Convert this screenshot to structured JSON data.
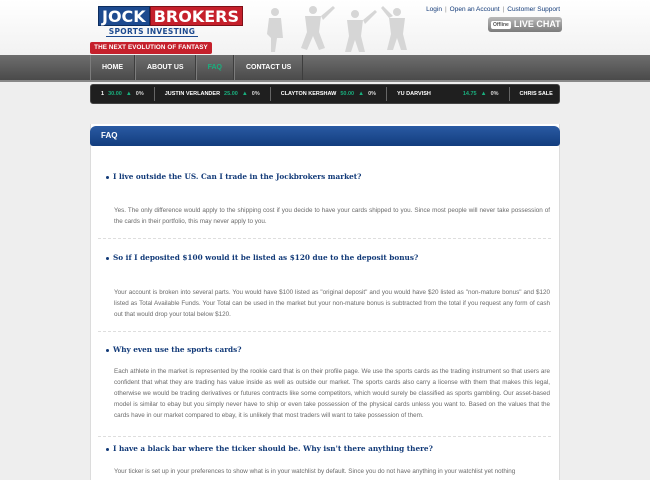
{
  "brand": {
    "name_part1": "JOCK",
    "name_part2": "BROKERS",
    "subtitle": "SPORTS INVESTING",
    "tagline": "THE NEXT EVOLUTION OF FANTASY SPORTS",
    "colors": {
      "blue": "#1d4a8f",
      "red": "#c5202b",
      "accent_green": "#19b07e"
    }
  },
  "top_links": [
    {
      "label": "Login"
    },
    {
      "label": "Open an Account"
    },
    {
      "label": "Customer Support"
    }
  ],
  "live_chat": {
    "badge": "Offline",
    "label": "LIVE CHAT"
  },
  "nav": [
    {
      "label": "HOME",
      "active": false
    },
    {
      "label": "ABOUT US",
      "active": false
    },
    {
      "label": "FAQ",
      "active": true
    },
    {
      "label": "CONTACT US",
      "active": false
    }
  ],
  "ticker": [
    {
      "name": "",
      "price": "1",
      "value": "30.00",
      "change": "0%"
    },
    {
      "name": "JUSTIN VERLANDER",
      "price": "",
      "value": "25.00",
      "change": "0%"
    },
    {
      "name": "CLAYTON KERSHAW",
      "price": "",
      "value": "50.00",
      "change": "0%"
    },
    {
      "name": "YU DARVISH",
      "price": "",
      "value": "14.75",
      "change": "0%"
    },
    {
      "name": "CHRIS SALE",
      "price": "",
      "value": "",
      "change": ""
    }
  ],
  "faq": {
    "header": "FAQ",
    "items": [
      {
        "question": "I live outside the US. Can I trade in the Jockbrokers market?",
        "answer": "Yes. The only difference would apply to the shipping cost if you decide to have your cards shipped to you. Since most people will never take possession of the cards in their portfolio, this may never apply to you."
      },
      {
        "question": "So if I deposited $100 would it be listed as $120 due to the deposit bonus?",
        "answer": "Your account is broken into several parts. You would have $100 listed as \"original deposit\" and you would have $20 listed as \"non-mature bonus\" and $120 listed as Total Available Funds. Your Total can be used in the market but your non-mature bonus is subtracted from the total if you request any form of cash out that would drop your total below $120."
      },
      {
        "question": "Why even use the sports cards?",
        "answer": "Each athlete in the market is represented by the rookie card that is on their profile page. We use the sports cards as the trading instrument so that users are confident that what they are trading has value inside as well as outside our market. The sports cards also carry a license with them that makes this legal, otherwise we would be trading derivatives or futures contracts like some competitors, which would surely be classified as sports gambling. Our asset-based model is similar to ebay but you simply never have to ship or even take possession of the physical cards unless you want to. Based on the values that the cards have in our market compared to ebay, it is unlikely that most traders will want to take possession of them."
      },
      {
        "question": "I have a black bar where the ticker should be. Why isn't there anything there?",
        "answer": "Your ticker is set up in your preferences to show what is in your watchlist by default. Since you do not have anything in your watchlist yet nothing"
      }
    ]
  }
}
